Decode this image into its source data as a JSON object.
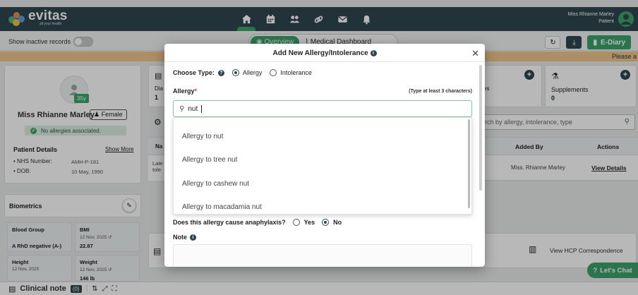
{
  "header": {
    "brand": "evitas",
    "tagline": "all your health",
    "user_name": "Miss Rhianne Marley",
    "user_role": "Patient"
  },
  "toolbar": {
    "show_inactive": "Show inactive records",
    "tabs": [
      "Overview",
      "Medical Dashboard"
    ],
    "ediary": "E-Diary"
  },
  "banner": {
    "text": "Please a"
  },
  "profile": {
    "age": "35y",
    "name": "Miss Rhianne Marley",
    "gender": "Female",
    "allergy_status": "No allergies associated.",
    "details_title": "Patient Details",
    "show_more": "Show More",
    "nhs_label": "NHS Number:",
    "nhs_value": "AMH-P-181",
    "dob_label": "DOB:",
    "dob_value": "10 May, 1990"
  },
  "biometrics": {
    "title": "Biometrics",
    "cells": [
      {
        "label": "Blood Group",
        "date": "",
        "value": "A RhD negative (A-)"
      },
      {
        "label": "BMI",
        "date": "12 Nov, 2025",
        "value": "22.87"
      },
      {
        "label": "Height",
        "date": "12 Nov, 2025",
        "value": ""
      },
      {
        "label": "Weight",
        "date": "12 Nov, 2025",
        "value": "146 lb"
      }
    ]
  },
  "background": {
    "card_left_partial": "Dia",
    "card_left_count": "1",
    "card_mid_partial": "es",
    "supplements_label": "Supplements",
    "supplements_count": "0",
    "search_placeholder": "rch by allergy, intolerance, type",
    "table_col_partial": "Na",
    "col_added_by": "Added By",
    "col_actions": "Actions",
    "row_partial_1": "Late",
    "row_partial_2": "tole",
    "row_added_by": "Miss. Rhianne Marley",
    "row_action": "View Details",
    "hcp_label": "View HCP Correspondence",
    "chat_label": "Let's Chat",
    "clinical_note": "Clinical note",
    "clinical_count": "(0)"
  },
  "modal": {
    "title": "Add New Allergy/Intolerance",
    "choose_type_label": "Choose Type:",
    "type_options": [
      "Allergy",
      "Intolerance"
    ],
    "allergy_label": "Allergy",
    "required_mark": "*",
    "hint": "(Type at least 3 characters)",
    "search_value": "nut",
    "suggestions": [
      "Allergy to nut",
      "Allergy to tree nut",
      "Allergy to cashew nut",
      "Allergy to macadamia nut"
    ],
    "anaphylaxis_question": "Does this allergy cause anaphylaxis?",
    "anaphylaxis_options": [
      "Yes",
      "No"
    ],
    "note_label": "Note"
  }
}
